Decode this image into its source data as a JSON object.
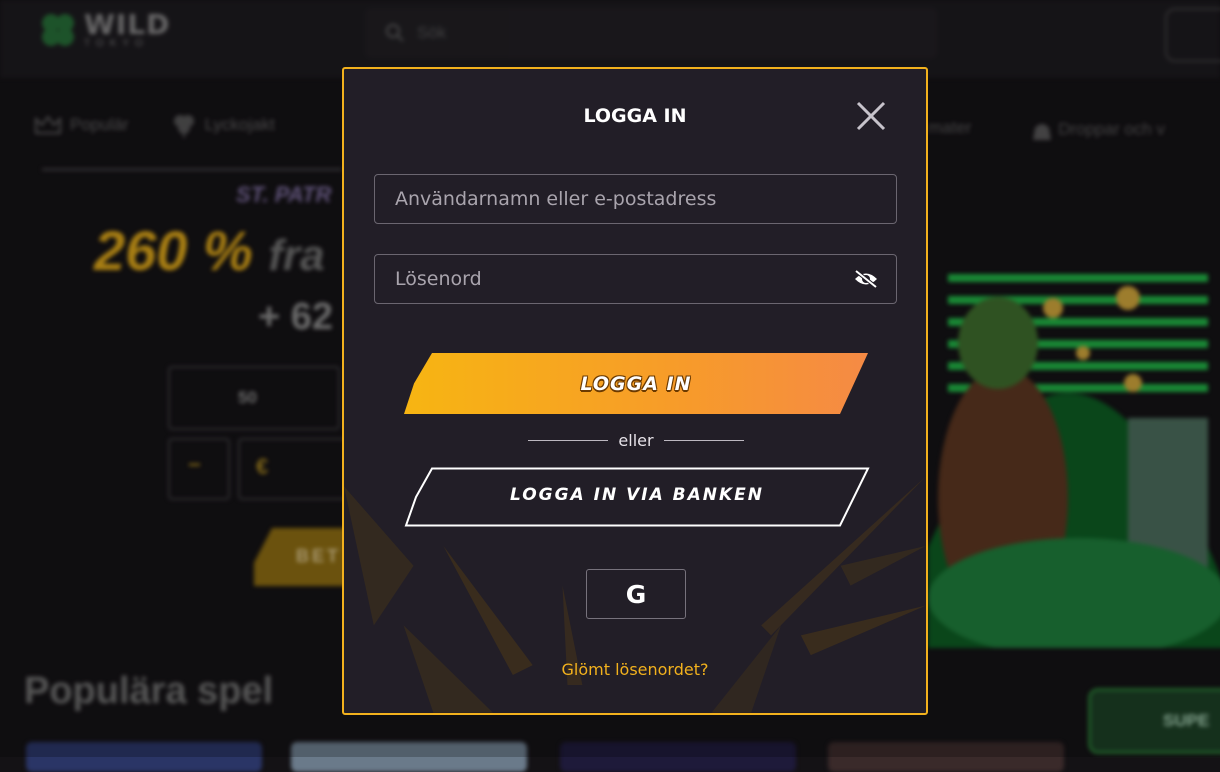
{
  "background": {
    "logo_text": "WILD",
    "logo_subtext": "TOKYO",
    "search_placeholder": "Sök",
    "nav_items": [
      "Populär",
      "Lyckojakt"
    ],
    "nav_items_right": [
      "mater",
      "Droppar och v"
    ],
    "promo_kicker": "ST. PATR",
    "promo_amount": "260 %",
    "promo_rest": "fra",
    "promo_plus": "+ 62",
    "amount_value": "50",
    "minus_label": "−",
    "currency_symbol": "€",
    "bet_button": "BET",
    "section_title": "Populära spel",
    "super_button": "SUPE"
  },
  "modal": {
    "title": "LOGGA IN",
    "username_placeholder": "Användarnamn eller e-postadress",
    "password_placeholder": "Lösenord",
    "login_button": "LOGGA IN",
    "separator": "eller",
    "bank_login_button": "LOGGA IN VIA BANKEN",
    "google_button": "G",
    "forgot_password": "Glömt lösenordet?"
  },
  "colors": {
    "accent": "#f2b11d",
    "modal_bg": "#221e27",
    "page_bg": "#141215",
    "login_gradient_start": "#f7b512",
    "login_gradient_end": "#f58a45"
  },
  "icons": [
    "clover-icon",
    "search-icon",
    "crown-icon",
    "clover-nav-icon",
    "bag-icon",
    "close-icon",
    "eye-off-icon",
    "google-icon"
  ]
}
